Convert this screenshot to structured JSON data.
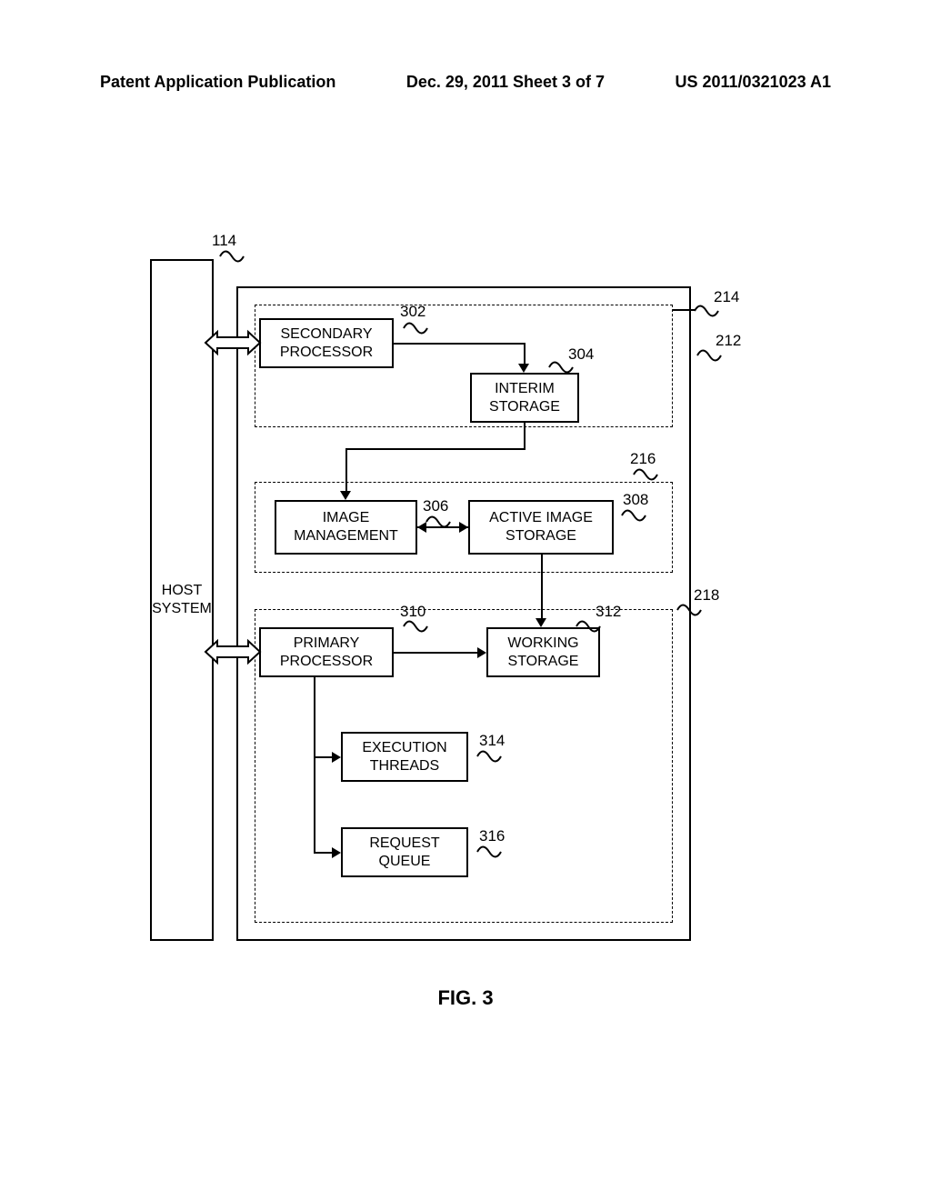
{
  "header": {
    "left": "Patent Application Publication",
    "middle": "Dec. 29, 2011  Sheet 3 of 7",
    "right": "US 2011/0321023 A1"
  },
  "figure_caption": "FIG. 3",
  "refs": {
    "r114": "114",
    "r212": "212",
    "r214": "214",
    "r216": "216",
    "r218": "218",
    "r302": "302",
    "r304": "304",
    "r306": "306",
    "r308": "308",
    "r310": "310",
    "r312": "312",
    "r314": "314",
    "r316": "316"
  },
  "labels": {
    "host": "HOST\nSYSTEM",
    "secondary_processor": "SECONDARY\nPROCESSOR",
    "interim_storage": "INTERIM\nSTORAGE",
    "image_management": "IMAGE\nMANAGEMENT",
    "active_image_storage": "ACTIVE IMAGE\nSTORAGE",
    "primary_processor": "PRIMARY\nPROCESSOR",
    "working_storage": "WORKING\nSTORAGE",
    "execution_threads": "EXECUTION\nTHREADS",
    "request_queue": "REQUEST\nQUEUE"
  }
}
